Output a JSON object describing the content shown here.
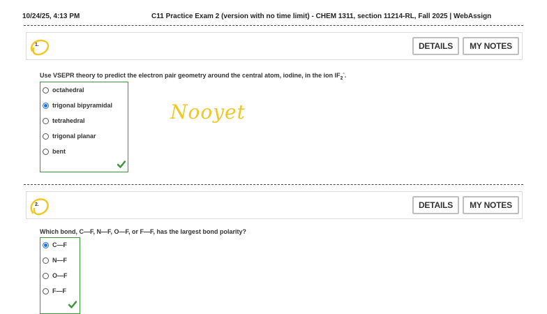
{
  "header": {
    "timestamp": "10/24/25, 4:13 PM",
    "title": "C11 Practice Exam 2 (version with no time limit) - CHEM 1311, section 11214-RL, Fall 2025 | WebAssign"
  },
  "questions": [
    {
      "number": "1.",
      "details_label": "DETAILS",
      "notes_label": "MY NOTES",
      "prompt_before": "Use VSEPR theory to predict the electron pair geometry around the central atom, iodine, in the ion IF",
      "prompt_sub": "2",
      "prompt_sup": "-",
      "prompt_after": ".",
      "options": [
        "octahedral",
        "trigonal bipyramidal",
        "tetrahedral",
        "trigonal planar",
        "bent"
      ],
      "selected_index": 1,
      "correct": true
    },
    {
      "number": "2.",
      "details_label": "DETAILS",
      "notes_label": "MY NOTES",
      "prompt": "Which bond, C—F, N—F, O—F, or F—F, has the largest bond polarity?",
      "options": [
        "C—F",
        "N—F",
        "O—F",
        "F—F"
      ],
      "selected_index": 0,
      "correct": true
    }
  ],
  "annotation": {
    "handwritten_note": "Nooyet"
  },
  "colors": {
    "correct_green": "#3a9a3a",
    "scribble_yellow": "#f3c623",
    "radio_blue": "#1a73e8"
  }
}
